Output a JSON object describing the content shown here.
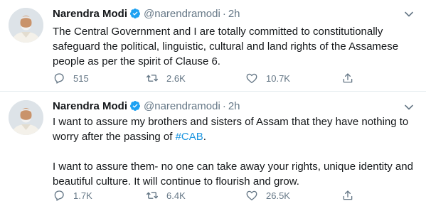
{
  "tweets": [
    {
      "author_name": "Narendra Modi",
      "handle": "@narendramodi",
      "separator": "·",
      "time": "2h",
      "lines": [
        "The Central Government and I are totally committed to constitutionally",
        "safeguard the political, linguistic, cultural and land rights of the Assamese",
        "people as per the spirit of Clause 6."
      ],
      "replies": "515",
      "retweets": "2.6K",
      "likes": "10.7K"
    },
    {
      "author_name": "Narendra Modi",
      "handle": "@narendramodi",
      "separator": "·",
      "time": "2h",
      "line1": "I want to assure my brothers and sisters of Assam that they have nothing to",
      "line2_prefix": "worry after the passing of ",
      "hashtag": "#CAB",
      "line2_suffix": ".",
      "line3": "I want to assure them- no one can take away your rights, unique identity and",
      "line4": "beautiful culture. It will continue to flourish and grow.",
      "replies": "1.7K",
      "retweets": "6.4K",
      "likes": "26.5K"
    }
  ],
  "icons": {
    "verified": "verified-badge-icon",
    "menu": "chevron-down-icon",
    "reply": "reply-icon",
    "retweet": "retweet-icon",
    "like": "heart-icon",
    "share": "share-icon"
  },
  "colors": {
    "text": "#14171a",
    "secondary": "#657786",
    "verified": "#1da1f2",
    "hashtag": "#1b95e0",
    "divider": "#e6ecf0"
  }
}
